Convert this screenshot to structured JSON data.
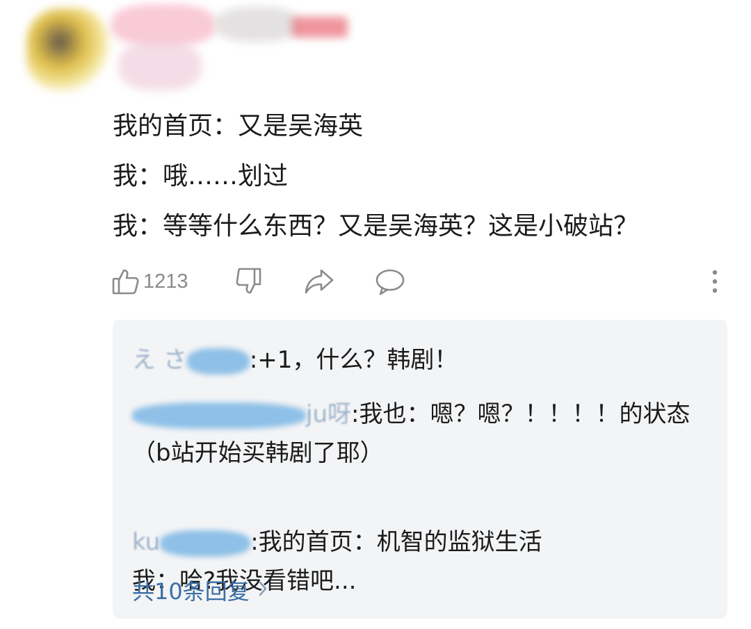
{
  "comment": {
    "lines": [
      "我的首页：又是吴海英",
      "我：哦……划过",
      "我：等等什么东西？又是吴海英？这是小破站？"
    ]
  },
  "actions": {
    "like_icon": "thumbs-up-icon",
    "like_count": "1213",
    "dislike_icon": "thumbs-down-icon",
    "share_icon": "share-icon",
    "comment_icon": "comment-bubble-icon",
    "more_icon": "more-vertical-icon"
  },
  "replies": [
    {
      "name_visible": "え さ",
      "separator": ":",
      "text": "+1，什么？韩剧！"
    },
    {
      "name_visible": "ju呀",
      "separator": ":",
      "text": "我也：嗯？嗯？！！！！的状态（b站开始买韩剧了耶）"
    },
    {
      "name_visible": "ku",
      "separator": ":",
      "text": "我的首页：机智的监狱生活\n我：哈?我没看错吧..."
    }
  ],
  "view_more": {
    "label": "共10条回复",
    "icon": "chevron-right-icon"
  }
}
